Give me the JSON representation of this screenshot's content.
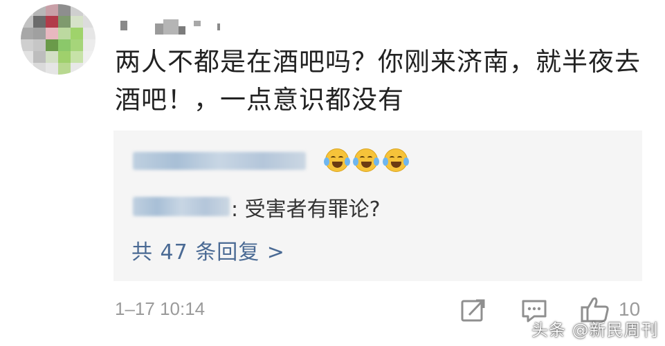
{
  "comment": {
    "text": "两人不都是在酒吧吗？你刚来济南，就半夜去酒吧！，一点意识都没有"
  },
  "replies": {
    "reply_2_text": ": 受害者有罪论?",
    "more_label": "共 47 条回复 >"
  },
  "meta": {
    "timestamp": "1–17 10:14",
    "like_count": "10"
  },
  "icons": {
    "share": "share-icon",
    "comment": "comment-icon",
    "like": "thumbs-up-icon",
    "emoji": "crying-laughing-emoji-icon"
  },
  "watermark": {
    "text": "头条 @新民周刊"
  },
  "colors": {
    "link": "#4a6a94",
    "text": "#222222",
    "muted": "#9a9a9a",
    "reply_bg": "#f5f5f5"
  }
}
